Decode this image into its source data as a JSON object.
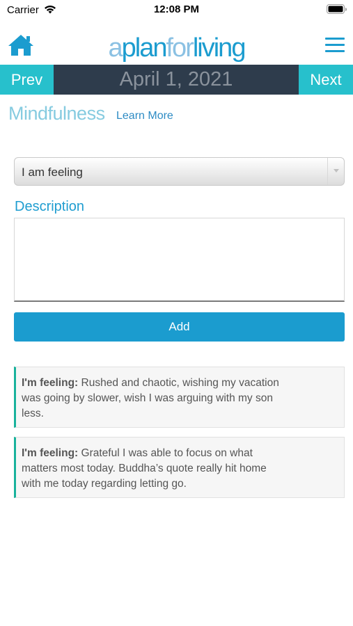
{
  "status": {
    "carrier": "Carrier",
    "time": "12:08 PM"
  },
  "header": {
    "logo_a": "a",
    "logo_plan": "plan",
    "logo_for": "for",
    "logo_living": "living",
    "home_icon": "home-icon",
    "menu_icon": "hamburger-menu-icon"
  },
  "date_nav": {
    "prev_label": "Prev",
    "date": "April 1, 2021",
    "next_label": "Next"
  },
  "section": {
    "title": "Mindfulness",
    "learn_more": "Learn More"
  },
  "form": {
    "select_value": "I am feeling",
    "description_label": "Description",
    "description_value": "",
    "add_label": "Add"
  },
  "entries": [
    {
      "prefix": "I'm feeling:",
      "text": "Rushed and chaotic, wishing my vacation was going by slower, wish I was arguing with my son less."
    },
    {
      "prefix": "I'm feeling:",
      "text": "Grateful I was able to focus on what matters most today. Buddha’s quote really hit home with me today regarding letting go."
    }
  ],
  "colors": {
    "accent": "#1b9ccf",
    "nav_teal": "#27c0cc",
    "nav_dark": "#2e3c4c",
    "entry_border": "#19b29c"
  }
}
